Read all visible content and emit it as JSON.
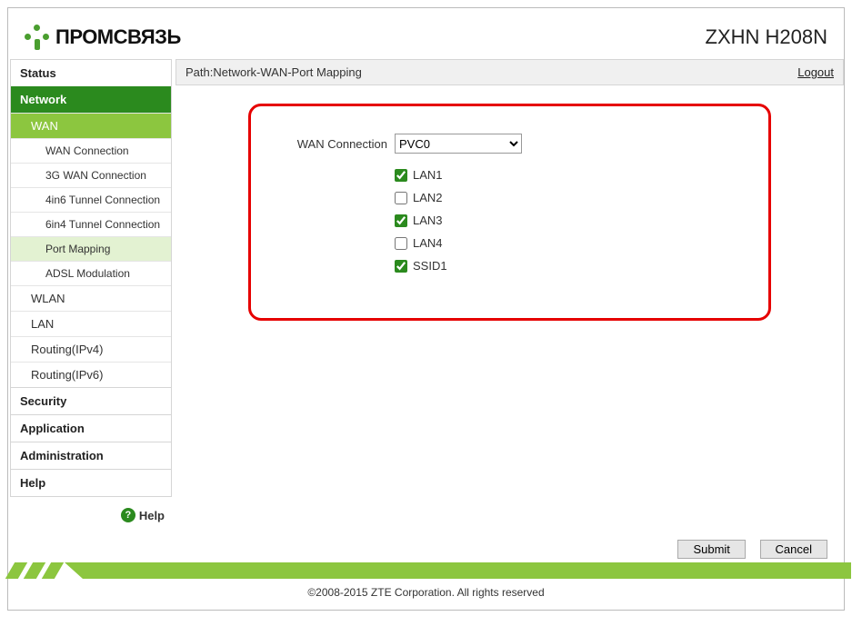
{
  "header": {
    "brand": "ПРОМСВЯЗЬ",
    "model": "ZXHN H208N"
  },
  "pathbar": {
    "path": "Path:Network-WAN-Port Mapping",
    "logout": "Logout"
  },
  "nav": {
    "cats": [
      {
        "label": "Status"
      },
      {
        "label": "Network"
      },
      {
        "label": "Security"
      },
      {
        "label": "Application"
      },
      {
        "label": "Administration"
      },
      {
        "label": "Help"
      }
    ],
    "network_subs": [
      {
        "label": "WAN"
      },
      {
        "label": "WLAN"
      },
      {
        "label": "LAN"
      },
      {
        "label": "Routing(IPv4)"
      },
      {
        "label": "Routing(IPv6)"
      }
    ],
    "wan_subs": [
      {
        "label": "WAN Connection"
      },
      {
        "label": "3G WAN Connection"
      },
      {
        "label": "4in6 Tunnel Connection"
      },
      {
        "label": "6in4 Tunnel Connection"
      },
      {
        "label": "Port Mapping"
      },
      {
        "label": "ADSL Modulation"
      }
    ]
  },
  "form": {
    "wan_label": "WAN Connection",
    "wan_selected": "PVC0",
    "checkboxes": [
      {
        "label": "LAN1",
        "checked": true
      },
      {
        "label": "LAN2",
        "checked": false
      },
      {
        "label": "LAN3",
        "checked": true
      },
      {
        "label": "LAN4",
        "checked": false
      },
      {
        "label": "SSID1",
        "checked": true
      }
    ]
  },
  "buttons": {
    "submit": "Submit",
    "cancel": "Cancel"
  },
  "footer": {
    "copyright": "©2008-2015 ZTE Corporation. All rights reserved"
  },
  "help_label": "Help"
}
